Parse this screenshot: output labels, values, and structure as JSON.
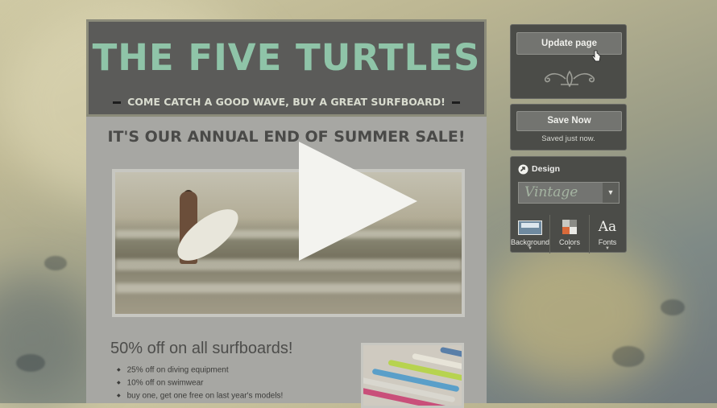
{
  "site": {
    "title": "THE FIVE TURTLES",
    "tagline": "COME CATCH A GOOD WAVE, BUY A GREAT SURFBOARD!",
    "sale_heading": "IT'S OUR ANNUAL END OF SUMMER SALE!",
    "promo_heading": "50% off on all surfboards!",
    "bullets": [
      "25% off on diving equipment",
      "10% off on swimwear",
      "buy one, get one free on last year's models!"
    ]
  },
  "editor": {
    "update_label": "Update page",
    "save_label": "Save Now",
    "saved_status": "Saved just now.",
    "design_label": "Design",
    "theme_selected": "Vintage",
    "tools": {
      "background": "Background",
      "colors": "Colors",
      "fonts": "Fonts",
      "fonts_glyph": "Aa"
    }
  },
  "icons": {
    "ornament": "ornament-icon",
    "cursor": "hand-cursor-icon",
    "design": "design-arrow-icon",
    "play": "play-icon"
  },
  "colors": {
    "title": "#8fc4a8",
    "header_bg": "#5b5b59",
    "panel_bg": "#4b4c48",
    "button_bg": "#737470"
  }
}
